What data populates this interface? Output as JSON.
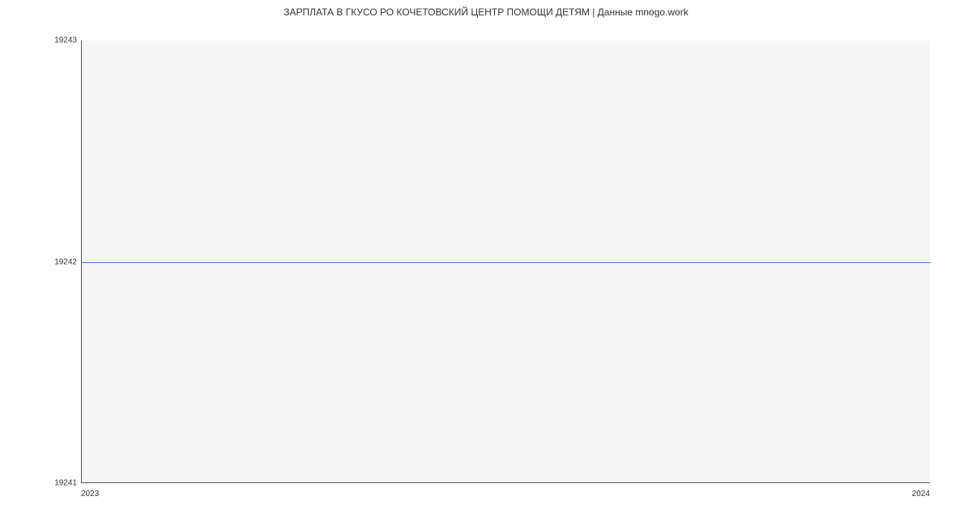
{
  "chart_data": {
    "type": "line",
    "title": "ЗАРПЛАТА В ГКУСО РО КОЧЕТОВСКИЙ ЦЕНТР ПОМОЩИ ДЕТЯМ | Данные mnogo.work",
    "x": [
      2023,
      2024
    ],
    "values": [
      19242,
      19242
    ],
    "xlabel": "",
    "ylabel": "",
    "ylim": [
      19241,
      19243
    ],
    "xlim": [
      2023,
      2024
    ],
    "y_ticks": [
      19241,
      19242,
      19243
    ],
    "x_ticks": [
      2023,
      2024
    ],
    "grid": false
  },
  "colors": {
    "line": "#3a7fd5",
    "plot_bg": "#f5f5f5"
  }
}
